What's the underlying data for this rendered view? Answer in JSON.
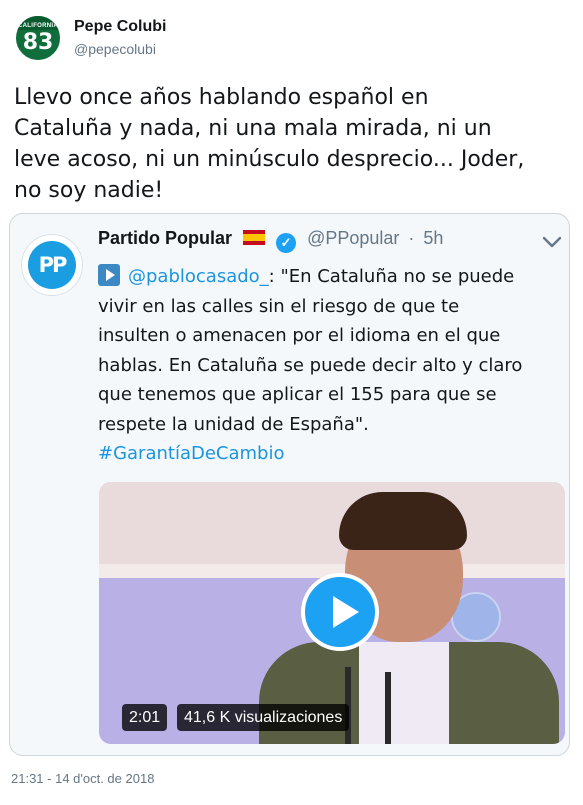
{
  "author": {
    "avatar_label": "83",
    "avatar_caption": "CALIFORNIA",
    "name": "Pepe Colubi",
    "handle": "@pepecolubi"
  },
  "tweet": {
    "text_lines": [
      "Llevo once años hablando español en",
      "Cataluña y nada, ni una mala mirada, ni un",
      "leve acoso, ni un minúsculo desprecio... Joder,",
      "no soy nadie!"
    ],
    "timestamp": "21:31 - 14 d'oct. de 2018"
  },
  "quoted": {
    "logo_text": "PP",
    "name": "Partido Popular",
    "handle": "@PPopular",
    "separator": "·",
    "time": "5h",
    "verified": true,
    "mention": "@pablocasado_",
    "text_first": ": \"En Cataluña no se puede",
    "text_lines": [
      "vivir en las calles sin el riesgo de que te",
      "insulten o amenacen por el idioma en el que",
      "hablas. En Cataluña se puede decir alto y claro",
      "que tenemos que aplicar el 155 para que se",
      "respete la unidad de España\"."
    ],
    "hashtag": "#GarantíaDeCambio",
    "video": {
      "duration": "2:01",
      "views": "41,6 K visualizaciones"
    }
  },
  "colors": {
    "link": "#1b95e0",
    "play_button": "#1da1f2",
    "muted": "#657786"
  }
}
